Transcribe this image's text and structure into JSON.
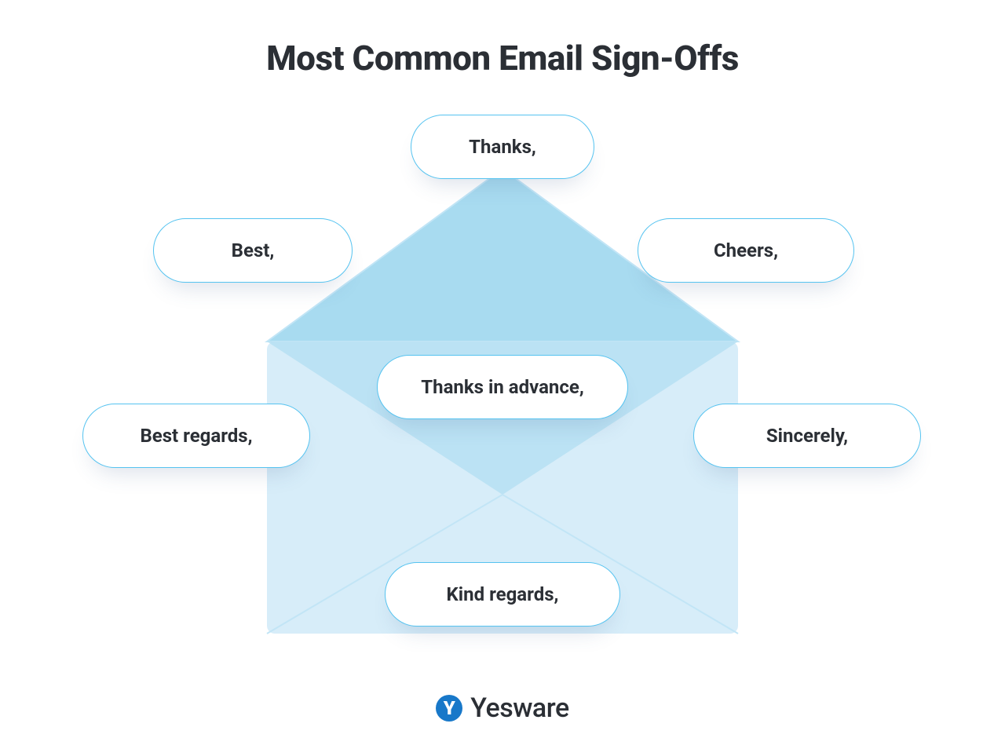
{
  "title": "Most Common Email Sign-Offs",
  "signoffs": {
    "top": "Thanks,",
    "upper_left": "Best,",
    "upper_right": "Cheers,",
    "center": "Thanks in advance,",
    "lower_left": "Best regards,",
    "lower_right": "Sincerely,",
    "bottom": "Kind regards,"
  },
  "brand": {
    "name": "Yesware",
    "mark_letter": "Y"
  },
  "palette": {
    "pill_border": "#55c3f0",
    "envelope_flap": "#a8dbf0",
    "envelope_body": "#d7edf9",
    "text": "#2b2f35",
    "brand_blue": "#1878c9"
  }
}
